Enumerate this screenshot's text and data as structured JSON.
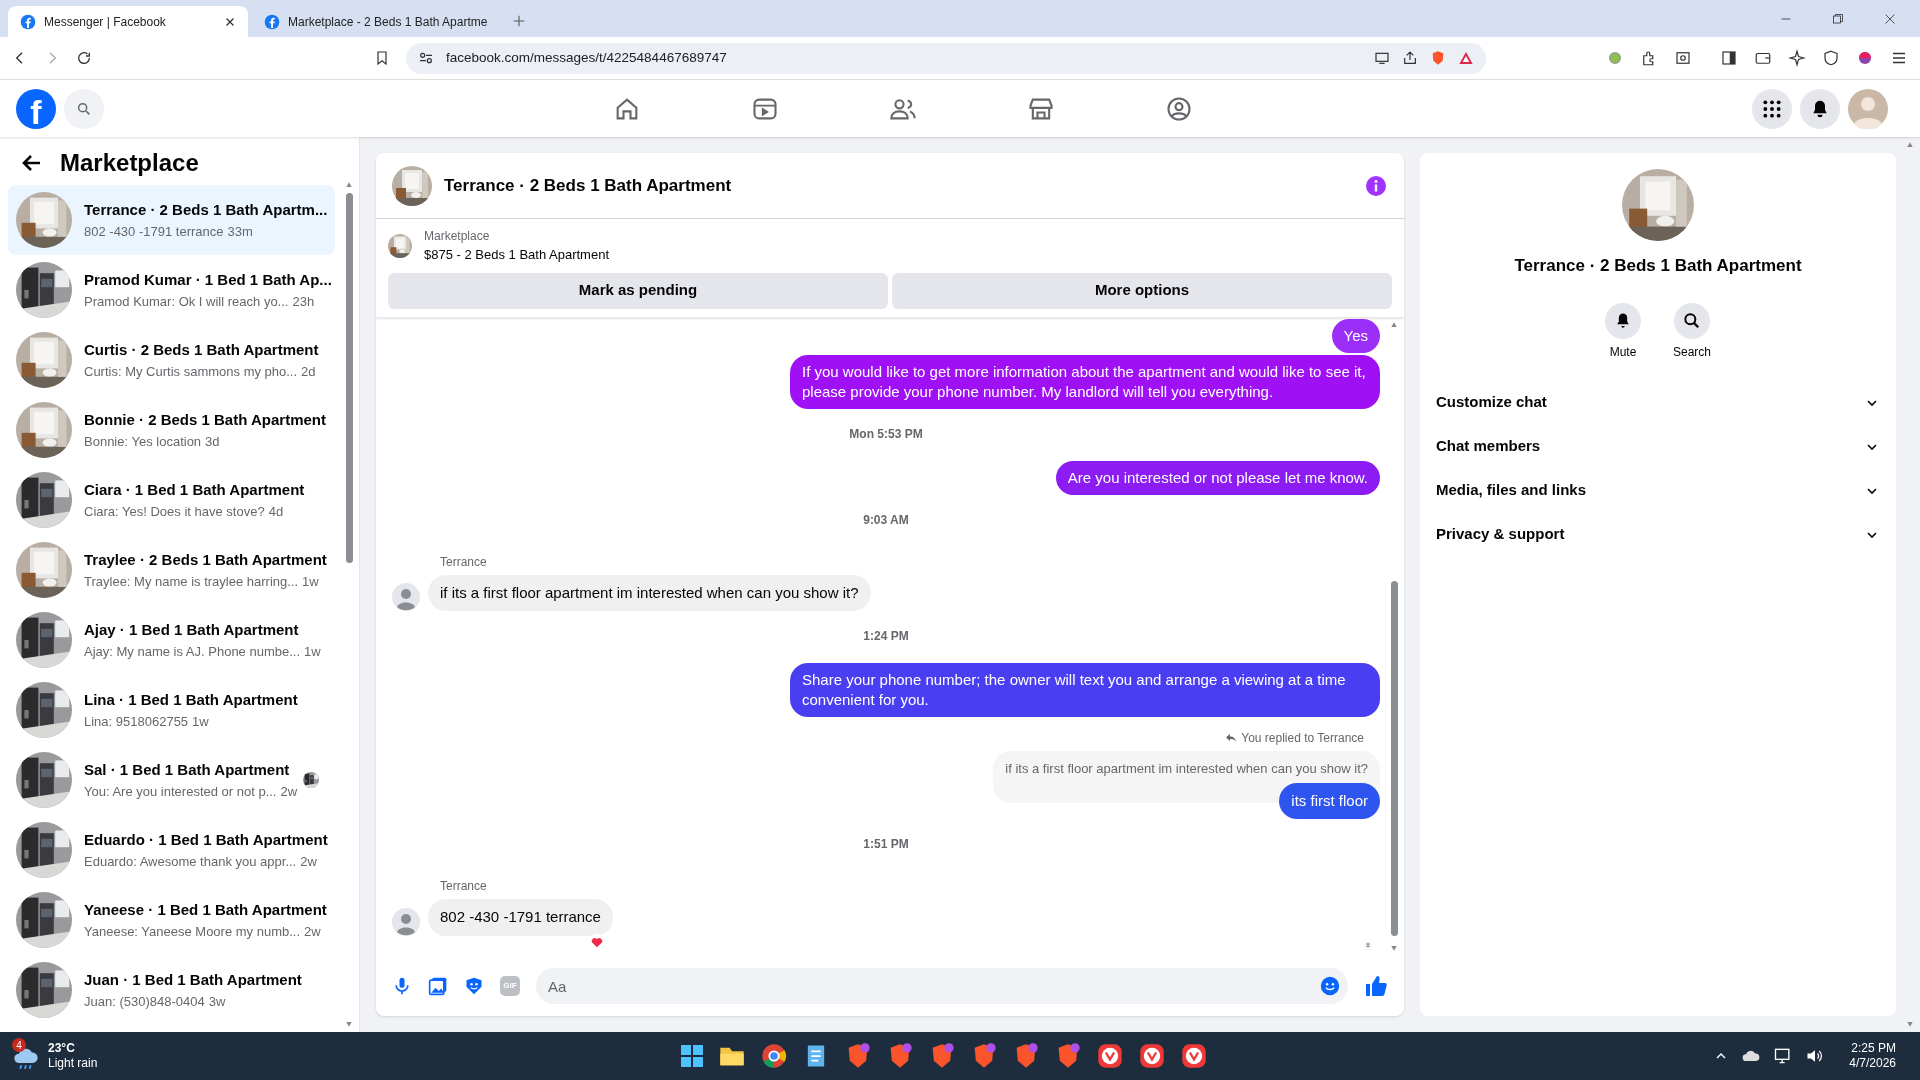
{
  "browser": {
    "tabs": [
      {
        "title": "Messenger | Facebook",
        "selected": true
      },
      {
        "title": "Marketplace - 2 Beds 1 Bath Apartme",
        "selected": false
      }
    ],
    "url": "facebook.com/messages/t/4225484467689747"
  },
  "header": {
    "logo": "f"
  },
  "sidebar": {
    "title": "Marketplace",
    "conversations": [
      {
        "title": "Terrance · 2 Beds 1 Bath Apartm...",
        "preview": "802 -430 -1791 terrance",
        "time": "33m",
        "selected": true,
        "seen": false
      },
      {
        "title": "Pramod Kumar · 1 Bed 1 Bath Ap...",
        "preview": "Pramod Kumar: Ok I will reach yo...",
        "time": "23h",
        "selected": false,
        "seen": false
      },
      {
        "title": "Curtis · 2 Beds 1 Bath Apartment",
        "preview": "Curtis: My Curtis sammons my pho...",
        "time": "2d",
        "selected": false,
        "seen": false
      },
      {
        "title": "Bonnie · 2 Beds 1 Bath Apartment",
        "preview": "Bonnie: Yes location",
        "time": "3d",
        "selected": false,
        "seen": false
      },
      {
        "title": "Ciara · 1 Bed 1 Bath Apartment",
        "preview": "Ciara: Yes! Does it have stove?",
        "time": "4d",
        "selected": false,
        "seen": false
      },
      {
        "title": "Traylee · 2 Beds 1 Bath Apartment",
        "preview": "Traylee: My name is traylee harring...",
        "time": "1w",
        "selected": false,
        "seen": false
      },
      {
        "title": "Ajay · 1 Bed 1 Bath Apartment",
        "preview": "Ajay: My name is AJ. Phone numbe...",
        "time": "1w",
        "selected": false,
        "seen": false
      },
      {
        "title": "Lina · 1 Bed 1 Bath Apartment",
        "preview": "Lina: 9518062755",
        "time": "1w",
        "selected": false,
        "seen": false
      },
      {
        "title": "Sal · 1 Bed 1 Bath Apartment",
        "preview": "You: Are you interested or not p...",
        "time": "2w",
        "selected": false,
        "seen": true
      },
      {
        "title": "Eduardo · 1 Bed 1 Bath Apartment",
        "preview": "Eduardo: Awesome thank you appr...",
        "time": "2w",
        "selected": false,
        "seen": false
      },
      {
        "title": "Yaneese · 1 Bed 1 Bath Apartment",
        "preview": "Yaneese: Yaneese Moore my numb...",
        "time": "2w",
        "selected": false,
        "seen": false
      },
      {
        "title": "Juan · 1 Bed 1 Bath Apartment",
        "preview": "Juan: (530)848-0404",
        "time": "3w",
        "selected": false,
        "seen": false
      }
    ]
  },
  "chat": {
    "title": "Terrance · 2 Beds 1 Bath Apartment",
    "listing": {
      "label": "Marketplace",
      "price_title": "$875 - 2 Beds 1 Bath Apartment"
    },
    "buttons": [
      "Mark as pending",
      "More options"
    ],
    "messages": [
      {
        "kind": "outgoing",
        "text": "Yes",
        "color": "#9b2ef7"
      },
      {
        "kind": "outgoing",
        "text": "If you would like to get more information about the apartment and would like to see it, please provide your phone number. My landlord will tell you everything.",
        "color": "#a010f5"
      },
      {
        "kind": "time",
        "text": "Mon 5:53 PM"
      },
      {
        "kind": "outgoing",
        "text": "Are you interested or not please let me know.",
        "color": "#8d1cf2"
      },
      {
        "kind": "time",
        "text": "9:03 AM"
      },
      {
        "kind": "incoming",
        "sender": "Terrance",
        "text": "if its a first floor apartment im interested when can you show it?",
        "reaction": false
      },
      {
        "kind": "time",
        "text": "1:24 PM"
      },
      {
        "kind": "outgoing",
        "text": "Share your phone number; the owner will text you and arrange a viewing at a time convenient for you.",
        "color": "#4a3ef2"
      },
      {
        "kind": "reply",
        "label": "You replied to Terrance",
        "quote": "if its a first floor apartment im interested when can you show it?",
        "text": "its first floor",
        "color": "#2e55f0"
      },
      {
        "kind": "time",
        "text": "1:51 PM"
      },
      {
        "kind": "incoming",
        "sender": "Terrance",
        "text": "802 -430 -1791 terrance",
        "reaction": true
      }
    ],
    "composer": {
      "gif": "GIF",
      "placeholder": "Aa"
    }
  },
  "details": {
    "title": "Terrance · 2 Beds 1 Bath Apartment",
    "actions": [
      "Mute",
      "Search"
    ],
    "sections": [
      "Customize chat",
      "Chat members",
      "Media, files and links",
      "Privacy & support"
    ]
  },
  "taskbar": {
    "weather": {
      "badge": "4",
      "temp": "23°C",
      "condition": "Light rain"
    },
    "time": "2:25 PM",
    "date": "4/7/2026"
  }
}
